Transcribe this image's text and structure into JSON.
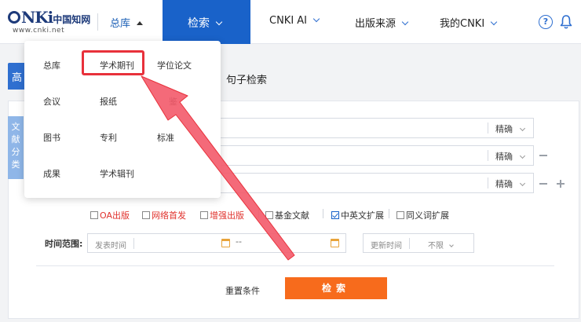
{
  "header": {
    "logo": {
      "text_cn": "中国知网",
      "url": "www.cnki.net",
      "mark": "CNKi"
    },
    "nav": {
      "zongku": "总库",
      "search": "检索",
      "cnki_ai": "CNKI AI",
      "source": "出版来源",
      "my_cnki": "我的CNKI"
    },
    "icons": [
      "help-icon",
      "bell-icon"
    ],
    "accent": "#1962c9"
  },
  "tabs": {
    "left_partial": "高",
    "sentence_search": "句子检索"
  },
  "dropdown": {
    "items": [
      {
        "label": "总库"
      },
      {
        "label": "学术期刊",
        "highlighted": true
      },
      {
        "label": "学位论文"
      },
      {
        "label": "会议"
      },
      {
        "label": "报纸"
      },
      {
        "label": "鉴"
      },
      {
        "label": "图书"
      },
      {
        "label": "专利"
      },
      {
        "label": "标准"
      },
      {
        "label": "成果"
      },
      {
        "label": "学术辑刊"
      }
    ]
  },
  "side_tag": "文献分类",
  "form": {
    "match_label": "精确",
    "checkboxes": [
      {
        "label": "OA出版",
        "checked": false,
        "red": true
      },
      {
        "label": "网络首发",
        "checked": false,
        "red": true
      },
      {
        "label": "增强出版",
        "checked": false,
        "red": true
      },
      {
        "label": "基金文献",
        "checked": false,
        "red": false
      },
      {
        "label": "中英文扩展",
        "checked": true,
        "red": false
      },
      {
        "label": "同义词扩展",
        "checked": false,
        "red": false
      }
    ],
    "time_label": "时间范围:",
    "publish_time_placeholder": "发表时间",
    "range_separator": "--",
    "update_time_placeholder": "更新时间",
    "update_time_value": "不限",
    "reset_label": "重置条件",
    "search_label": "检索",
    "search_button_color": "#f76b1c"
  }
}
